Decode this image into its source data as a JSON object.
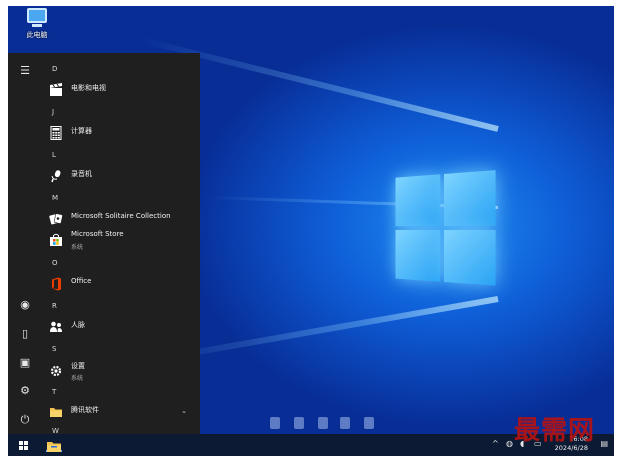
{
  "desktop": {
    "icon_label": "此电脑"
  },
  "start_menu": {
    "rail": {
      "menu_glyph": "☰",
      "user_glyph": "◉",
      "documents_glyph": "▯",
      "pictures_glyph": "▣",
      "settings_glyph": "⚙",
      "power_glyph": "⏻"
    },
    "headers": [
      "D",
      "J",
      "L",
      "M",
      "O",
      "R",
      "S",
      "T",
      "W"
    ],
    "apps": [
      {
        "name": "电影和电视",
        "sub": ""
      },
      {
        "name": "计算器",
        "sub": ""
      },
      {
        "name": "录音机",
        "sub": ""
      },
      {
        "name": "Microsoft Solitaire Collection",
        "sub": ""
      },
      {
        "name": "Microsoft Store",
        "sub": "系统"
      },
      {
        "name": "Office",
        "sub": ""
      },
      {
        "name": "人脉",
        "sub": ""
      },
      {
        "name": "设置",
        "sub": "系统"
      },
      {
        "name": "腾讯软件",
        "sub": ""
      }
    ],
    "folder_chevron": "⌄"
  },
  "taskbar": {
    "tray_arrow": "^",
    "clock_time": "16:08",
    "clock_date": "2024/6/28",
    "watermark": "最需网"
  },
  "colors": {
    "start_bg": "#1f1f1f",
    "taskbar_bg": "#0d1a33",
    "accent": "#1e8cf0"
  }
}
